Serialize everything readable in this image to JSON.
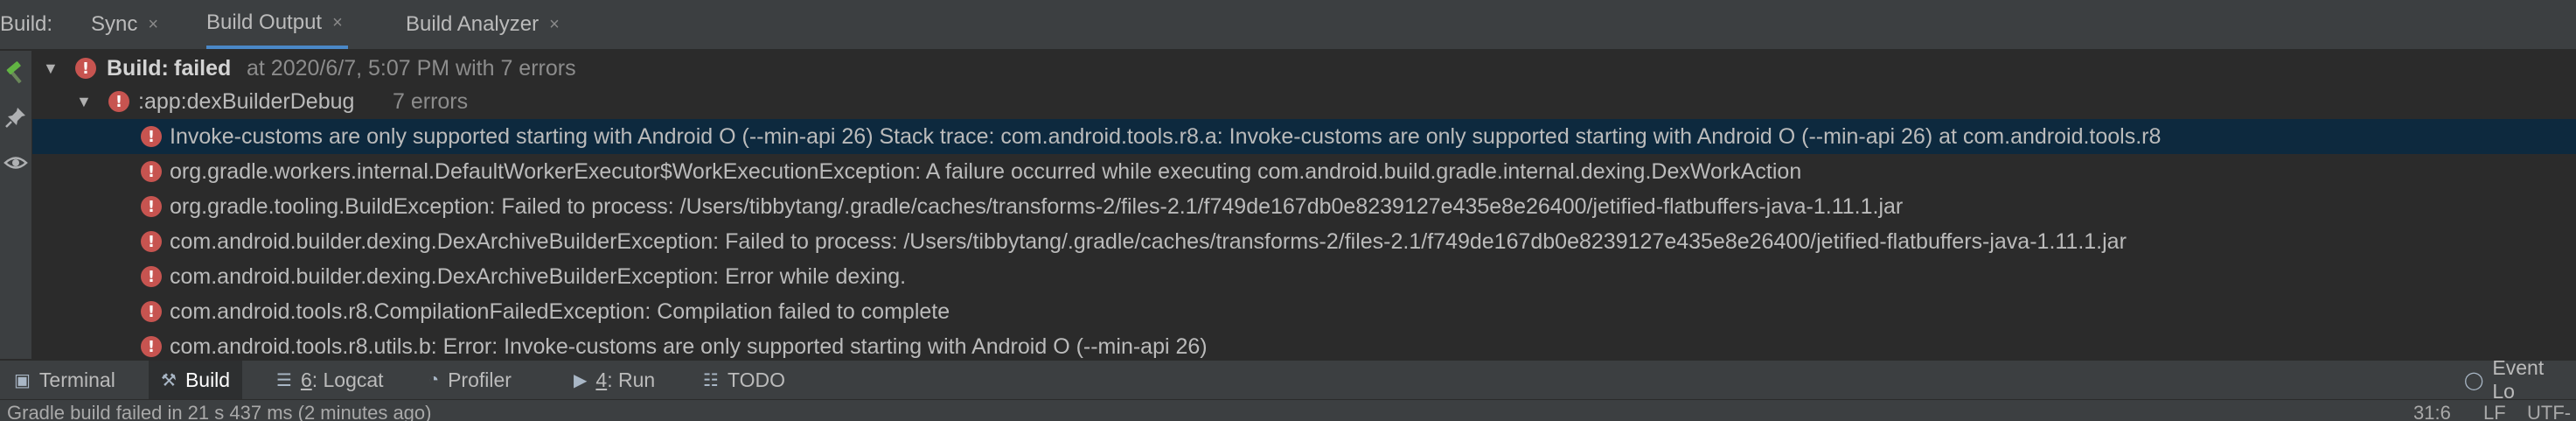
{
  "tabbar": {
    "label": "Build:",
    "tabs": [
      {
        "label": "Sync",
        "close": "×"
      },
      {
        "label": "Build Output",
        "close": "×"
      },
      {
        "label": "Build Analyzer",
        "close": "×"
      }
    ]
  },
  "sidebar": {
    "icons": [
      "hammer-icon",
      "pin-icon",
      "eye-icon"
    ]
  },
  "tree": {
    "root": {
      "label": "Build:",
      "status": "failed",
      "detail": "at 2020/6/7, 5:07 PM with 7 errors"
    },
    "task": {
      "label": ":app:dexBuilderDebug",
      "detail": "7 errors"
    },
    "errors": [
      "Invoke-customs are only supported starting with Android O (--min-api 26) Stack trace: com.android.tools.r8.a: Invoke-customs are only supported starting with Android O (--min-api 26)  at com.android.tools.r8",
      "org.gradle.workers.internal.DefaultWorkerExecutor$WorkExecutionException: A failure occurred while executing com.android.build.gradle.internal.dexing.DexWorkAction",
      "org.gradle.tooling.BuildException: Failed to process: /Users/tibbytang/.gradle/caches/transforms-2/files-2.1/f749de167db0e8239127e435e8e26400/jetified-flatbuffers-java-1.11.1.jar",
      "com.android.builder.dexing.DexArchiveBuilderException: Failed to process: /Users/tibbytang/.gradle/caches/transforms-2/files-2.1/f749de167db0e8239127e435e8e26400/jetified-flatbuffers-java-1.11.1.jar",
      "com.android.builder.dexing.DexArchiveBuilderException: Error while dexing.",
      "com.android.tools.r8.CompilationFailedException: Compilation failed to complete",
      "com.android.tools.r8.utils.b: Error: Invoke-customs are only supported starting with Android O (--min-api 26)"
    ]
  },
  "toolwindows": {
    "terminal": "Terminal",
    "build": "Build",
    "logcat_num": "6",
    "logcat": ": Logcat",
    "profiler": "Profiler",
    "run_num": "4",
    "run": ": Run",
    "todo": "TODO",
    "event_log": "Event Lo"
  },
  "status": {
    "message": "Gradle build failed in 21 s 437 ms (2 minutes ago)",
    "position": "31:6",
    "line_sep": "LF",
    "encoding": "UTF-"
  },
  "colors": {
    "error": "#c75450",
    "selection": "#0d293e",
    "accent": "#4a88c7"
  }
}
